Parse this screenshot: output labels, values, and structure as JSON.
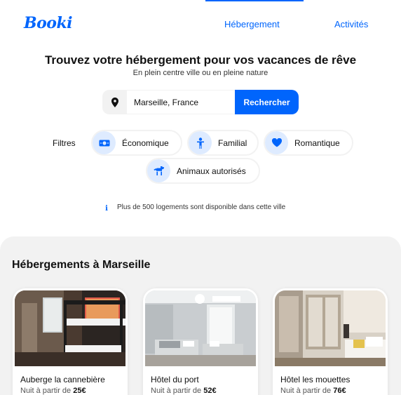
{
  "logo": "Booki",
  "nav": {
    "hebergement": "Hébergement",
    "activites": "Activités"
  },
  "hero": {
    "title": "Trouvez votre hébergement pour vos vacances de rêve",
    "subtitle": "En plein centre ville ou en pleine nature"
  },
  "search": {
    "value": "Marseille, France",
    "button": "Rechercher"
  },
  "filters": {
    "label": "Filtres",
    "items": [
      {
        "label": "Économique",
        "icon": "money-icon"
      },
      {
        "label": "Familial",
        "icon": "child-icon"
      },
      {
        "label": "Romantique",
        "icon": "heart-icon"
      },
      {
        "label": "Animaux autorisés",
        "icon": "dog-icon"
      }
    ]
  },
  "info": {
    "icon": "info-icon",
    "text": "Plus de 500 logements sont disponible dans cette ville"
  },
  "section": {
    "title": "Hébergements à Marseille"
  },
  "cards": [
    {
      "name": "Auberge la cannebière",
      "price_prefix": "Nuit à partir de",
      "price": "25€"
    },
    {
      "name": "Hôtel du port",
      "price_prefix": "Nuit à partir de",
      "price": "52€"
    },
    {
      "name": "Hôtel les mouettes",
      "price_prefix": "Nuit à partir de",
      "price": "76€"
    }
  ],
  "colors": {
    "accent": "#0065fc",
    "chip_icon_bg": "#deebff",
    "section_bg": "#f2f2f2"
  }
}
